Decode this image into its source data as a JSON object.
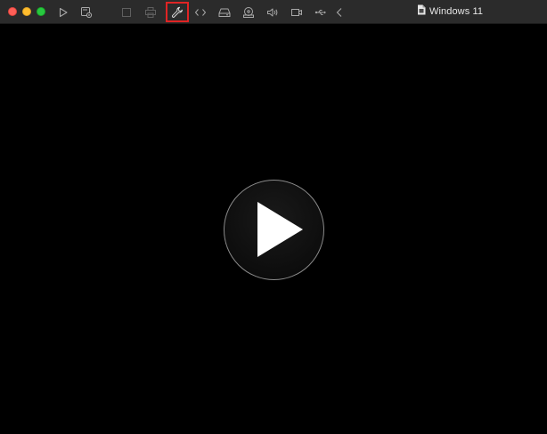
{
  "window": {
    "title": "Windows 11"
  },
  "toolbar": {
    "buttons": [
      {
        "name": "start-button",
        "icon": "play-outline-icon"
      },
      {
        "name": "snapshot-button",
        "icon": "snapshot-gear-icon"
      },
      {
        "name": "stop-button",
        "icon": "square-outline-icon",
        "disabled": true
      },
      {
        "name": "print-button",
        "icon": "printer-icon",
        "disabled": true
      },
      {
        "name": "settings-button",
        "icon": "wrench-icon",
        "highlighted": true
      },
      {
        "name": "code-button",
        "icon": "angle-brackets-icon"
      },
      {
        "name": "hard-disk-button",
        "icon": "hard-disk-icon"
      },
      {
        "name": "cd-dvd-button",
        "icon": "optical-drive-icon"
      },
      {
        "name": "sound-button",
        "icon": "speaker-icon"
      },
      {
        "name": "camera-button",
        "icon": "video-camera-icon"
      },
      {
        "name": "usb-button",
        "icon": "usb-icon"
      },
      {
        "name": "back-button",
        "icon": "chevron-left-icon"
      }
    ]
  },
  "content": {
    "play_icon": "play-circle-icon"
  },
  "colors": {
    "titlebar": "#2b2b2b",
    "background": "#000000",
    "highlight": "#e02424",
    "close": "#fe5f57",
    "minimize": "#febc2e",
    "maximize": "#28c840"
  }
}
